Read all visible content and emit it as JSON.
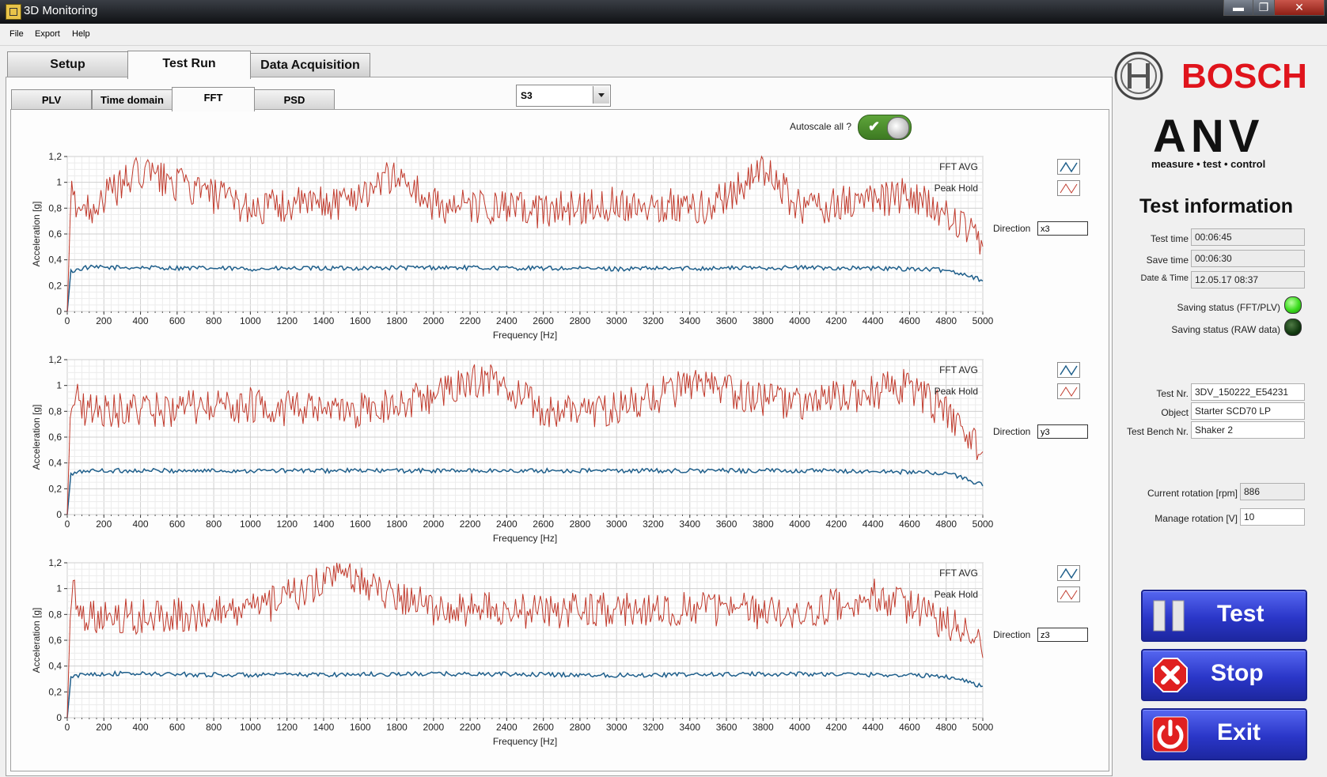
{
  "window": {
    "title": "3D Monitoring",
    "minimize": "▬",
    "maximize": "❐",
    "close": "✕"
  },
  "menu": [
    "File",
    "Export",
    "Help"
  ],
  "tabs": [
    "Setup",
    "Test Run",
    "Data Acquisition"
  ],
  "subtabs": [
    "PLV",
    "Time domain",
    "FFT",
    "PSD"
  ],
  "sensor_select": {
    "value": "S3"
  },
  "autoscale": {
    "label": "Autoscale all ?",
    "on": true
  },
  "graphs": [
    {
      "direction_label": "Direction",
      "direction": "x3",
      "legend": [
        "FFT AVG",
        "Peak Hold"
      ]
    },
    {
      "direction_label": "Direction",
      "direction": "y3",
      "legend": [
        "FFT AVG",
        "Peak Hold"
      ]
    },
    {
      "direction_label": "Direction",
      "direction": "z3",
      "legend": [
        "FFT AVG",
        "Peak Hold"
      ]
    }
  ],
  "chart_data": [
    {
      "type": "line",
      "xlabel": "Frequency [Hz]",
      "ylabel": "Acceleration [g]",
      "xlim": [
        0,
        5000
      ],
      "ylim": [
        0,
        1.2
      ],
      "xticks": [
        "0",
        "200",
        "400",
        "600",
        "800",
        "1000",
        "1200",
        "1400",
        "1600",
        "1800",
        "2000",
        "2200",
        "2400",
        "2600",
        "2800",
        "3000",
        "3200",
        "3400",
        "3600",
        "3800",
        "4000",
        "4200",
        "4400",
        "4600",
        "4800",
        "5000"
      ],
      "yticks": [
        "0",
        "0,2",
        "0,4",
        "0,6",
        "0,8",
        "1",
        "1,2"
      ],
      "grid": true,
      "legend_position": "right",
      "series": [
        {
          "name": "FFT AVG",
          "color": "#1f5f8b",
          "x": [
            0,
            20,
            100,
            400,
            1000,
            2000,
            3000,
            4000,
            4600,
            4800,
            4900,
            5000
          ],
          "values": [
            0,
            0.31,
            0.34,
            0.34,
            0.33,
            0.34,
            0.33,
            0.34,
            0.33,
            0.32,
            0.29,
            0.24
          ]
        },
        {
          "name": "Peak Hold",
          "color": "#c0392b",
          "x": [
            0,
            20,
            100,
            400,
            1000,
            1500,
            1800,
            2000,
            2600,
            3000,
            3500,
            3800,
            4000,
            4600,
            4900,
            5000
          ],
          "values": [
            0,
            0.9,
            0.78,
            1.08,
            0.8,
            0.85,
            1.06,
            0.82,
            0.78,
            0.84,
            0.8,
            1.1,
            0.8,
            0.9,
            0.65,
            0.47
          ]
        }
      ]
    },
    {
      "type": "line",
      "xlabel": "Frequency [Hz]",
      "ylabel": "Acceleration [g]",
      "xlim": [
        0,
        5000
      ],
      "ylim": [
        0,
        1.2
      ],
      "xticks": [
        "0",
        "200",
        "400",
        "600",
        "800",
        "1000",
        "1200",
        "1400",
        "1600",
        "1800",
        "2000",
        "2200",
        "2400",
        "2600",
        "2800",
        "3000",
        "3200",
        "3400",
        "3600",
        "3800",
        "4000",
        "4200",
        "4400",
        "4600",
        "4800",
        "5000"
      ],
      "yticks": [
        "0",
        "0,2",
        "0,4",
        "0,6",
        "0,8",
        "1",
        "1,2"
      ],
      "grid": true,
      "legend_position": "right",
      "series": [
        {
          "name": "FFT AVG",
          "color": "#1f5f8b",
          "x": [
            0,
            20,
            100,
            400,
            1000,
            2000,
            3000,
            4000,
            4600,
            4800,
            4900,
            5000
          ],
          "values": [
            0,
            0.31,
            0.34,
            0.34,
            0.34,
            0.34,
            0.34,
            0.34,
            0.33,
            0.32,
            0.28,
            0.23
          ]
        },
        {
          "name": "Peak Hold",
          "color": "#c0392b",
          "x": [
            0,
            20,
            100,
            400,
            1000,
            1500,
            2000,
            2300,
            2600,
            3000,
            3400,
            4000,
            4600,
            4900,
            5000
          ],
          "values": [
            0,
            0.95,
            0.82,
            0.8,
            0.85,
            0.78,
            0.92,
            1.06,
            0.8,
            0.82,
            1.0,
            0.85,
            1.0,
            0.66,
            0.49
          ]
        }
      ]
    },
    {
      "type": "line",
      "xlabel": "Frequency [Hz]",
      "ylabel": "Acceleration [g]",
      "xlim": [
        0,
        5000
      ],
      "ylim": [
        0,
        1.2
      ],
      "xticks": [
        "0",
        "200",
        "400",
        "600",
        "800",
        "1000",
        "1200",
        "1400",
        "1600",
        "1800",
        "2000",
        "2200",
        "2400",
        "2600",
        "2800",
        "3000",
        "3200",
        "3400",
        "3600",
        "3800",
        "4000",
        "4200",
        "4400",
        "4600",
        "4800",
        "5000"
      ],
      "yticks": [
        "0",
        "0,2",
        "0,4",
        "0,6",
        "0,8",
        "1",
        "1,2"
      ],
      "grid": true,
      "legend_position": "right",
      "series": [
        {
          "name": "FFT AVG",
          "color": "#1f5f8b",
          "x": [
            0,
            20,
            100,
            400,
            1000,
            2000,
            3000,
            4000,
            4600,
            4800,
            4900,
            5000
          ],
          "values": [
            0,
            0.31,
            0.34,
            0.34,
            0.33,
            0.34,
            0.33,
            0.34,
            0.33,
            0.32,
            0.29,
            0.24
          ]
        },
        {
          "name": "Peak Hold",
          "color": "#c0392b",
          "x": [
            0,
            20,
            100,
            400,
            1000,
            1500,
            2000,
            2600,
            3000,
            3500,
            4000,
            4400,
            4600,
            4900,
            5000
          ],
          "values": [
            0,
            1.0,
            0.8,
            0.78,
            0.82,
            1.1,
            0.85,
            0.82,
            0.84,
            0.85,
            0.8,
            0.95,
            0.85,
            0.68,
            0.57
          ]
        }
      ]
    }
  ],
  "logos": {
    "bosch": "BOSCH",
    "anv": "ANV",
    "anv_tagline": "measure • test • control"
  },
  "test_info": {
    "title": "Test information",
    "test_time_label": "Test time",
    "test_time": "00:06:45",
    "save_time_label": "Save time",
    "save_time": "00:06:30",
    "datetime_label": "Date & Time",
    "datetime": "12.05.17 08:37",
    "saving_fft_label": "Saving status (FFT/PLV)",
    "saving_fft_color": "#3bdc1e",
    "saving_raw_label": "Saving status (RAW data)",
    "saving_raw_color": "#123a10",
    "test_nr_label": "Test Nr.",
    "test_nr": "3DV_150222_E54231",
    "object_label": "Object",
    "object": "Starter SCD70 LP",
    "bench_label": "Test Bench Nr.",
    "bench": "Shaker 2",
    "rotation_label": "Current rotation [rpm]",
    "rotation": "886",
    "manage_label": "Manage rotation [V]",
    "manage": "10"
  },
  "buttons": {
    "test": "Test",
    "stop": "Stop",
    "exit": "Exit"
  }
}
